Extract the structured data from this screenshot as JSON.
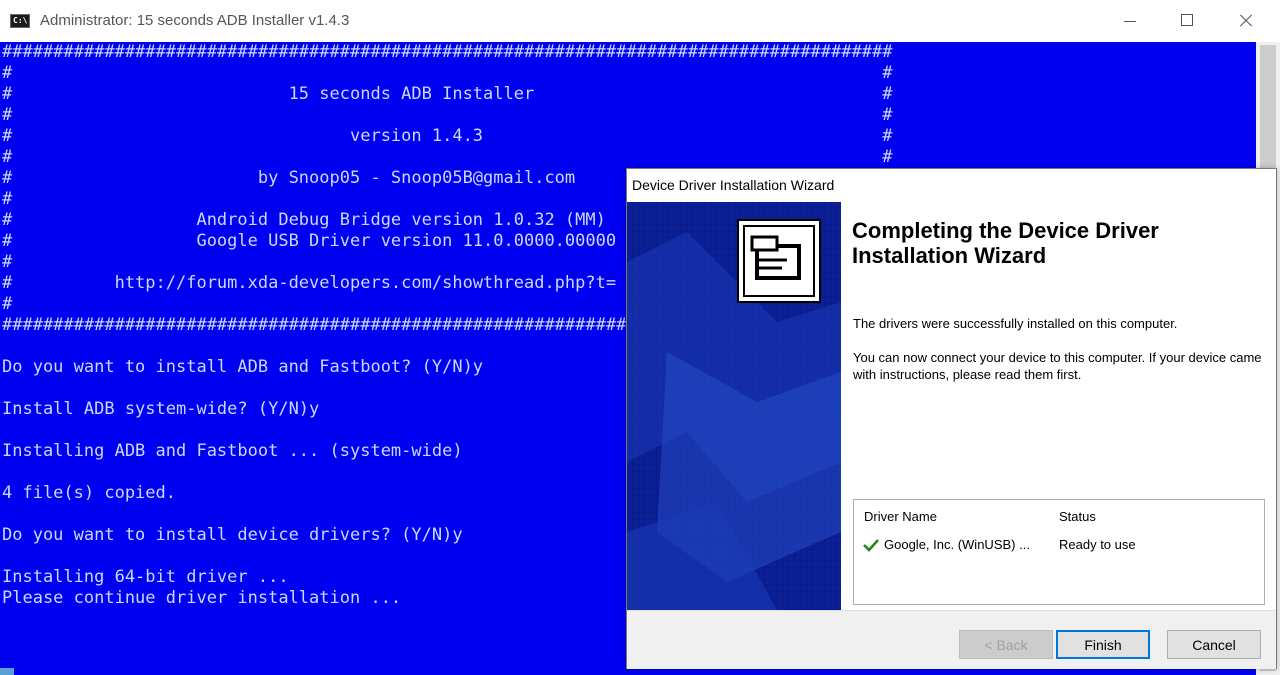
{
  "console": {
    "title": "Administrator:  15 seconds ADB Installer v1.4.3",
    "lines": [
      "#######################################################################################",
      "#                                                                                     #",
      "#                           15 seconds ADB Installer                                  #",
      "#                                                                                     #",
      "#                                 version 1.4.3                                       #",
      "#                                                                                     #",
      "#                        by Snoop05 - Snoop05B@gmail.com",
      "#",
      "#                  Android Debug Bridge version 1.0.32 (MM)",
      "#                  Google USB Driver version 11.0.0000.00000",
      "#",
      "#          http://forum.xda-developers.com/showthread.php?t=",
      "#",
      "##############################################################",
      "",
      "Do you want to install ADB and Fastboot? (Y/N)y",
      "",
      "Install ADB system-wide? (Y/N)y",
      "",
      "Installing ADB and Fastboot ... (system-wide)",
      "",
      "4 file(s) copied.",
      "",
      "Do you want to install device drivers? (Y/N)y",
      "",
      "Installing 64-bit driver ...",
      "Please continue driver installation ..."
    ]
  },
  "wizard": {
    "title": "Device Driver Installation Wizard",
    "heading": "Completing the Device Driver Installation Wizard",
    "message1": "The drivers were successfully installed on this computer.",
    "message2": "You can now connect your device to this computer. If your device came with instructions, please read them first.",
    "table": {
      "headers": [
        "Driver Name",
        "Status"
      ],
      "rows": [
        {
          "name": "Google, Inc. (WinUSB) ...",
          "status": "Ready to use"
        }
      ]
    },
    "buttons": {
      "back": "< Back",
      "finish": "Finish",
      "cancel": "Cancel"
    }
  },
  "colors": {
    "console_bg": "#0000f0",
    "console_text": "#c8d8ff",
    "banner_bg": "#0a1a8c",
    "focus_border": "#0078d7",
    "check": "#1a8a1a"
  },
  "icons": {
    "console": "cmd-icon",
    "banner": "hardware-icon",
    "row_status": "check-icon"
  }
}
